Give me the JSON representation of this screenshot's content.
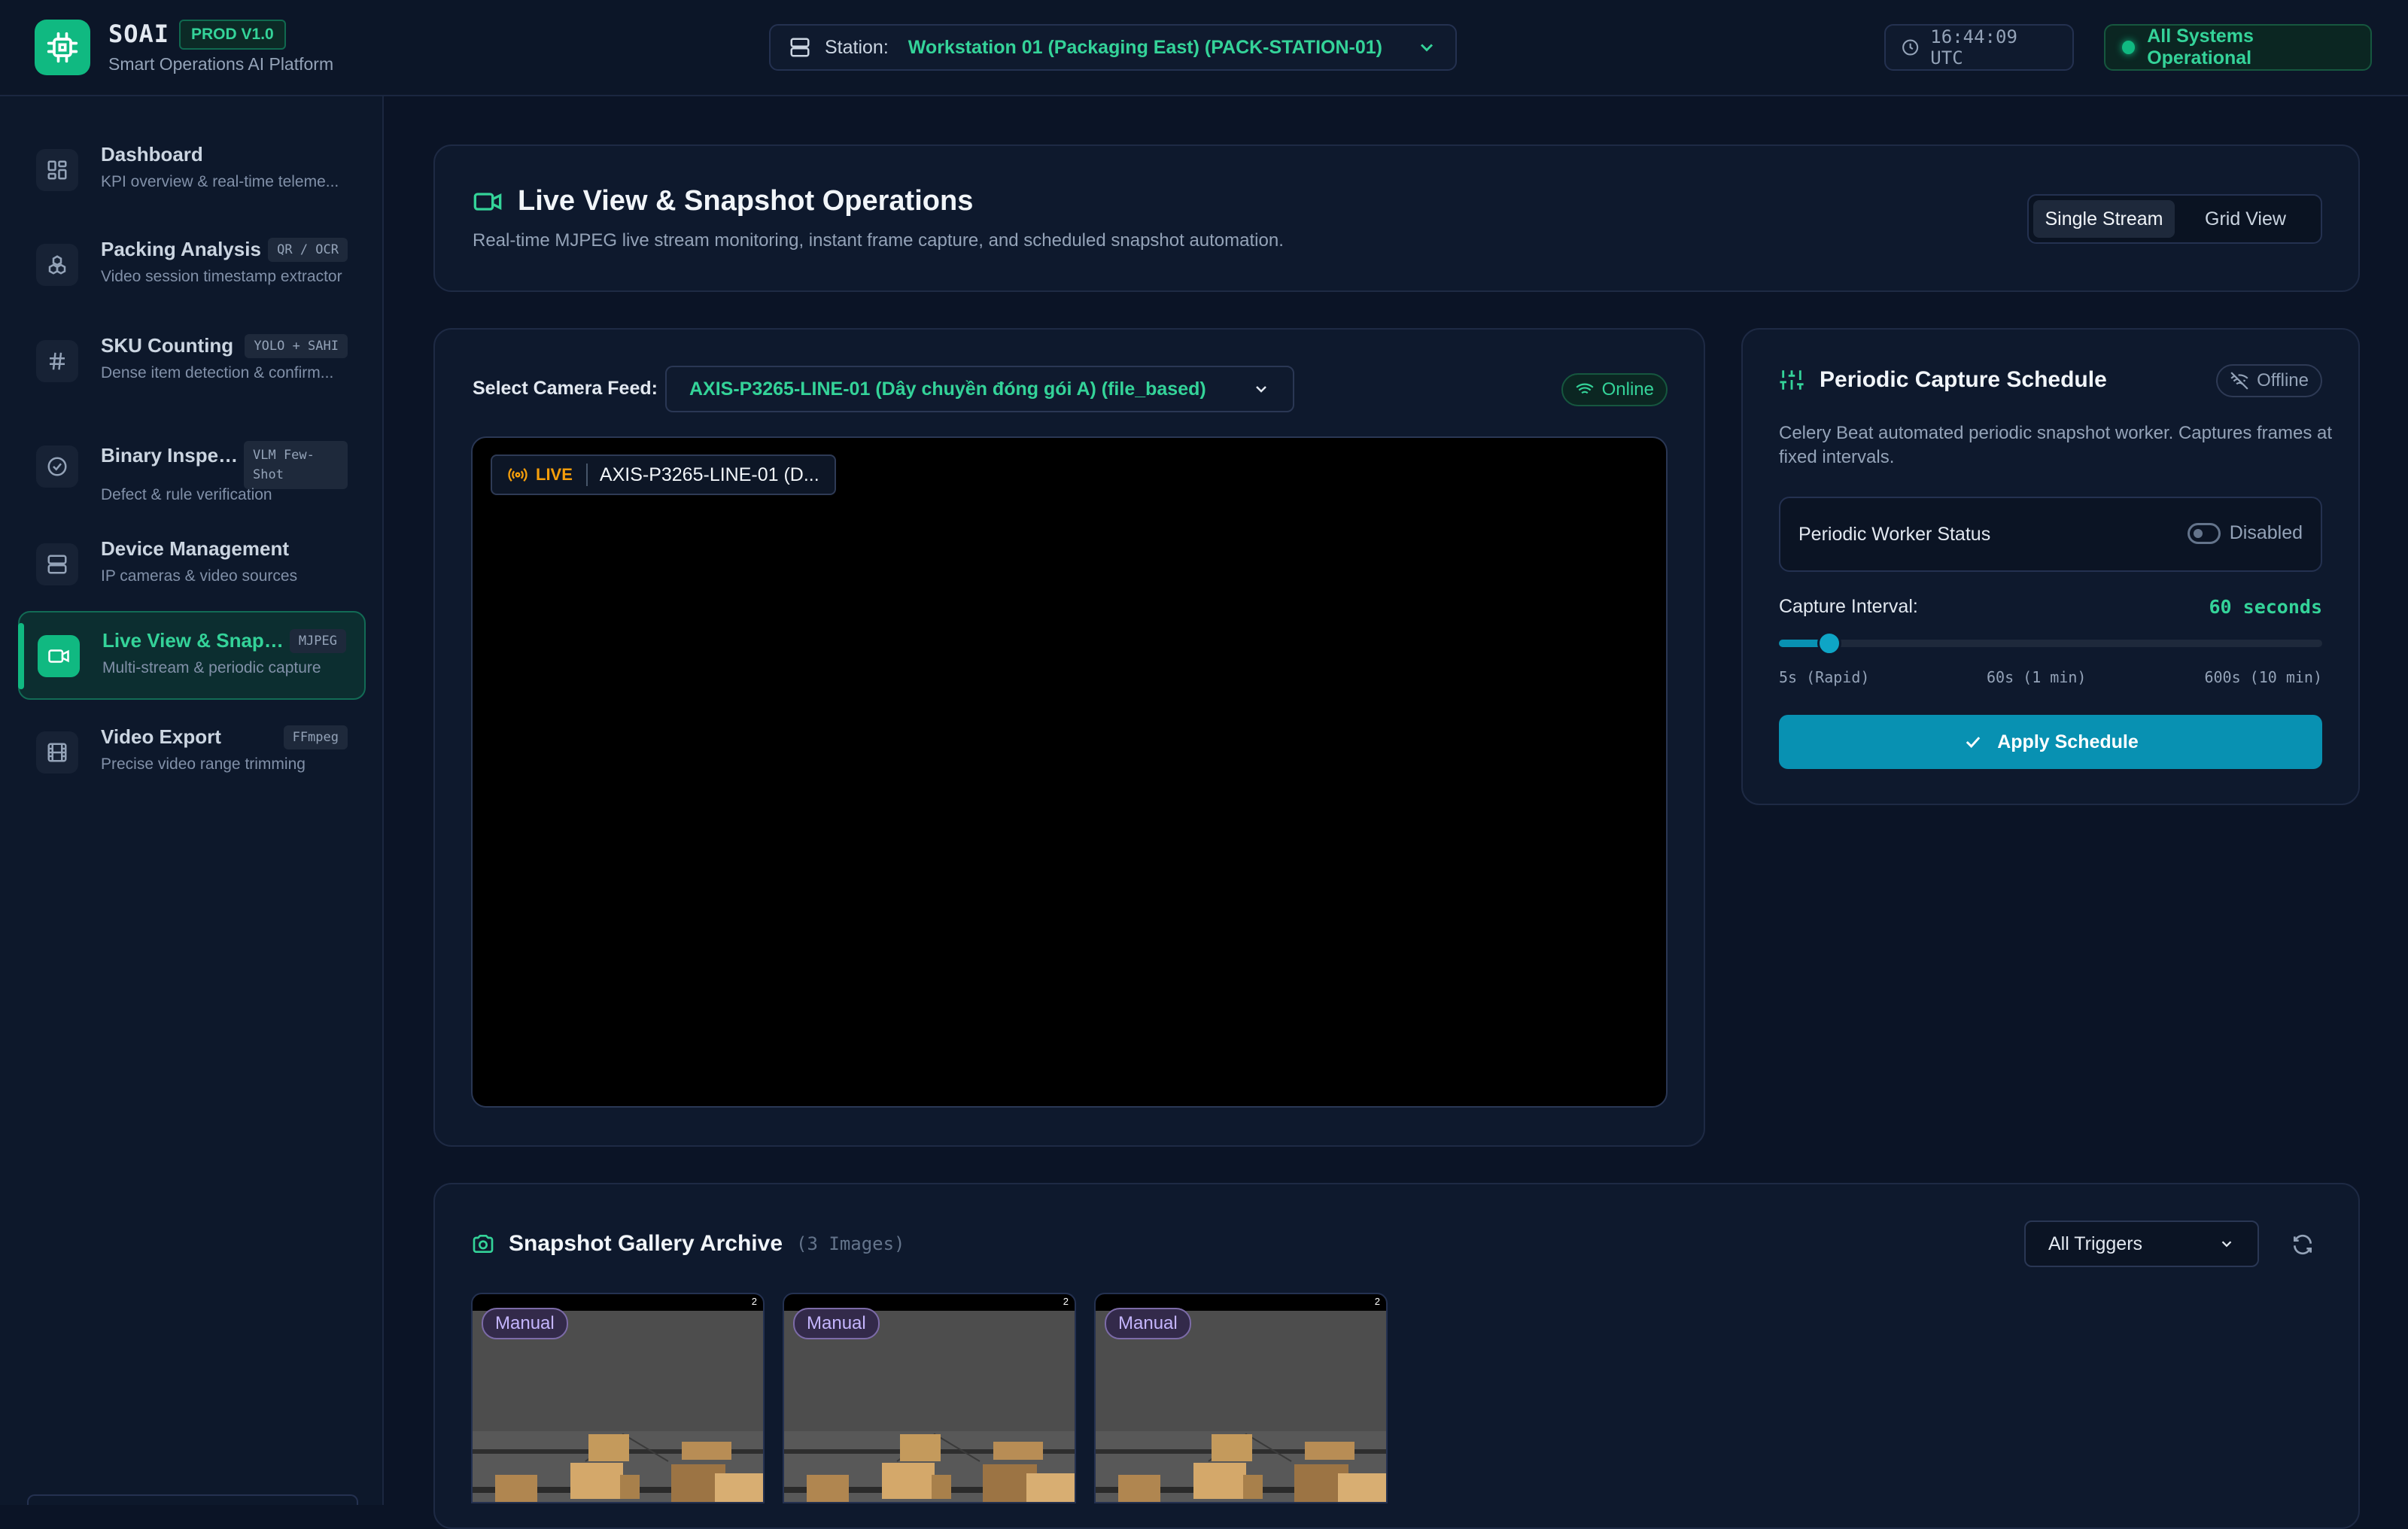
{
  "header": {
    "brand": "SOAI",
    "badge": "PROD V1.0",
    "subtitle": "Smart Operations AI Platform",
    "station_label": "Station:",
    "station_value": "Workstation 01 (Packaging East) (PACK-STATION-01)",
    "clock": "16:44:09 UTC",
    "system_status": "All Systems Operational"
  },
  "sidebar": {
    "items": [
      {
        "label": "Dashboard",
        "sub": "KPI overview & real-time teleme...",
        "badge": ""
      },
      {
        "label": "Packing Analysis",
        "sub": "Video session timestamp extractor",
        "badge": "QR / OCR"
      },
      {
        "label": "SKU Counting",
        "sub": "Dense item detection & confirm...",
        "badge": "YOLO + SAHI"
      },
      {
        "label": "Binary Inspect...",
        "sub": "Defect & rule verification",
        "badge": "VLM Few-Shot"
      },
      {
        "label": "Device Management",
        "sub": "IP cameras & video sources",
        "badge": ""
      },
      {
        "label": "Live View & Snapsh...",
        "sub": "Multi-stream & periodic capture",
        "badge": "MJPEG"
      },
      {
        "label": "Video Export",
        "sub": "Precise video range trimming",
        "badge": "FFmpeg"
      }
    ]
  },
  "hero": {
    "title": "Live View & Snapshot Operations",
    "subtitle": "Real-time MJPEG live stream monitoring, instant frame capture, and scheduled snapshot automation.",
    "modes": [
      "Single Stream",
      "Grid View"
    ],
    "active_mode": "Single Stream"
  },
  "camera": {
    "label": "Select Camera Feed:",
    "selected": "AXIS-P3265-LINE-01 (Dây chuyền đóng gói A) (file_based)",
    "status": "Online",
    "live_tag": "LIVE",
    "overlay_name": "AXIS-P3265-LINE-01 (D..."
  },
  "schedule": {
    "title": "Periodic Capture Schedule",
    "status": "Offline",
    "description": "Celery Beat automated periodic snapshot worker. Captures frames at fixed intervals.",
    "worker_label": "Periodic Worker Status",
    "worker_state": "Disabled",
    "interval_label": "Capture Interval:",
    "interval_value": "60 seconds",
    "interval_seconds": 60,
    "interval_min": 5,
    "interval_max": 600,
    "ticks": [
      "5s (Rapid)",
      "60s (1 min)",
      "600s (10 min)"
    ],
    "apply_label": "Apply Schedule"
  },
  "gallery": {
    "title": "Snapshot Gallery Archive",
    "count": "(3 Images)",
    "filter": "All Triggers",
    "items": [
      {
        "tag": "Manual",
        "corner": "2"
      },
      {
        "tag": "Manual",
        "corner": "2"
      },
      {
        "tag": "Manual",
        "corner": "2"
      }
    ]
  },
  "colors": {
    "accent": "#10b981",
    "accent_text": "#34d399",
    "primary_button": "#0891b2",
    "background": "#0b1426"
  }
}
